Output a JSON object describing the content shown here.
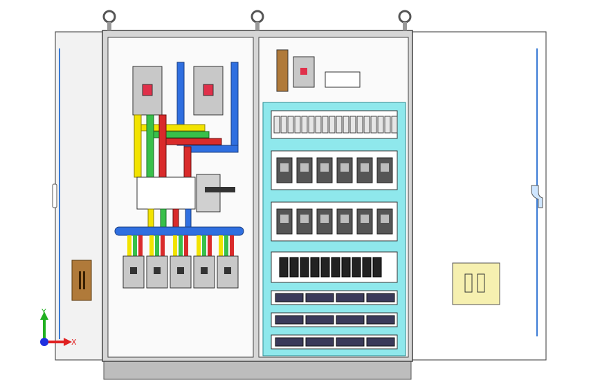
{
  "axes": {
    "x_label": "X",
    "y_label": "Y"
  },
  "label_plates": [
    "",
    ""
  ],
  "colors": {
    "background": "#ffffff",
    "cabinet_body": "#d6d6d6",
    "cabinet_edge": "#555555",
    "door_panel": "#f2f2f2",
    "mounting_plate": "#fafafa",
    "busbar_blue": "#2f6fe0",
    "busbar_yellow": "#f2e300",
    "busbar_green": "#38c04a",
    "busbar_red": "#d92b2b",
    "din_rail_cyan": "#8fe8ec",
    "breaker_gray": "#bfbfbf",
    "breaker_dark": "#333333",
    "handle_red": "#e0304a",
    "wood_panel": "#b07a3a",
    "plaque_yellow": "#f6f0b0",
    "axis_x": "#e02020",
    "axis_y": "#20b020",
    "axis_z": "#2030e0"
  },
  "components": {
    "lifting_eyes": 3,
    "main_breakers": 2,
    "outgoing_breakers": 5,
    "relay_rows": [
      6,
      6
    ],
    "terminal_block_count": 10,
    "terminal_strip_rows": 3,
    "terminal_strip_segments": 4
  },
  "icons": [
    "lifting-eye-icon",
    "door-handle-icon",
    "coordinate-triad-icon"
  ]
}
